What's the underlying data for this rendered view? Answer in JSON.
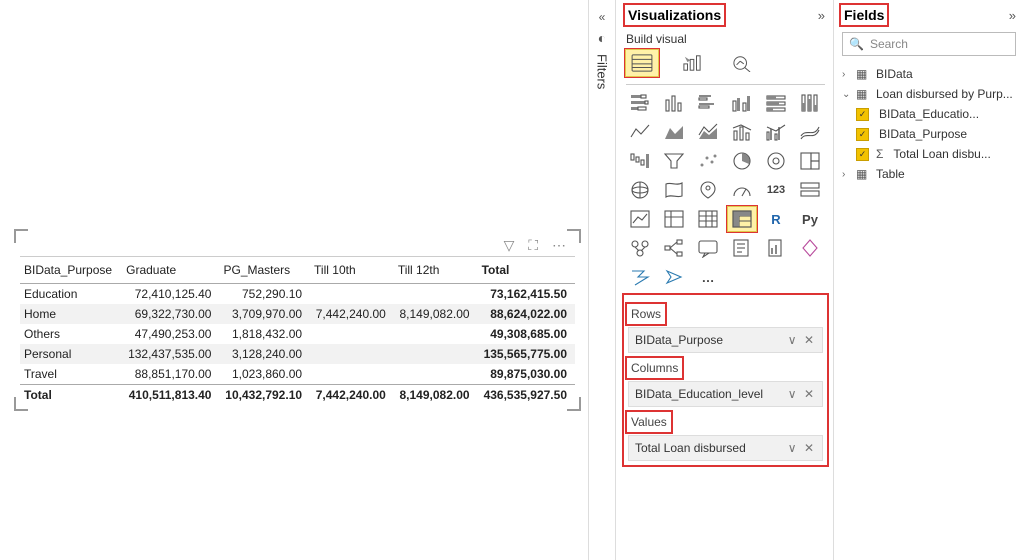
{
  "matrix": {
    "columns": [
      "BIData_Purpose",
      "Graduate",
      "PG_Masters",
      "Till 10th",
      "Till 12th",
      "Total"
    ],
    "rows": [
      {
        "label": "Education",
        "vals": [
          "72,410,125.40",
          "752,290.10",
          "",
          "",
          "73,162,415.50"
        ],
        "alt": false
      },
      {
        "label": "Home",
        "vals": [
          "69,322,730.00",
          "3,709,970.00",
          "7,442,240.00",
          "8,149,082.00",
          "88,624,022.00"
        ],
        "alt": true
      },
      {
        "label": "Others",
        "vals": [
          "47,490,253.00",
          "1,818,432.00",
          "",
          "",
          "49,308,685.00"
        ],
        "alt": false
      },
      {
        "label": "Personal",
        "vals": [
          "132,437,535.00",
          "3,128,240.00",
          "",
          "",
          "135,565,775.00"
        ],
        "alt": true
      },
      {
        "label": "Travel",
        "vals": [
          "88,851,170.00",
          "1,023,860.00",
          "",
          "",
          "89,875,030.00"
        ],
        "alt": false
      }
    ],
    "total": {
      "label": "Total",
      "vals": [
        "410,511,813.40",
        "10,432,792.10",
        "7,442,240.00",
        "8,149,082.00",
        "436,535,927.50"
      ]
    }
  },
  "filtersRail": {
    "label": "Filters"
  },
  "viz": {
    "title": "Visualizations",
    "build_label": "Build visual",
    "grid_more": "…",
    "wells": {
      "rows": {
        "label": "Rows",
        "field": "BIData_Purpose"
      },
      "columns": {
        "label": "Columns",
        "field": "BIData_Education_level"
      },
      "values": {
        "label": "Values",
        "field": "Total Loan disbursed"
      }
    }
  },
  "fields": {
    "title": "Fields",
    "search_placeholder": "Search",
    "tables": [
      {
        "name": "BIData",
        "expanded": false
      },
      {
        "name": "Loan disbursed by Purp...",
        "expanded": true,
        "children": [
          {
            "name": "BIData_Educatio...",
            "checked": true,
            "measure": false
          },
          {
            "name": "BIData_Purpose",
            "checked": true,
            "measure": false
          },
          {
            "name": "Total Loan disbu...",
            "checked": true,
            "measure": true
          }
        ]
      },
      {
        "name": "Table",
        "expanded": false
      }
    ]
  }
}
